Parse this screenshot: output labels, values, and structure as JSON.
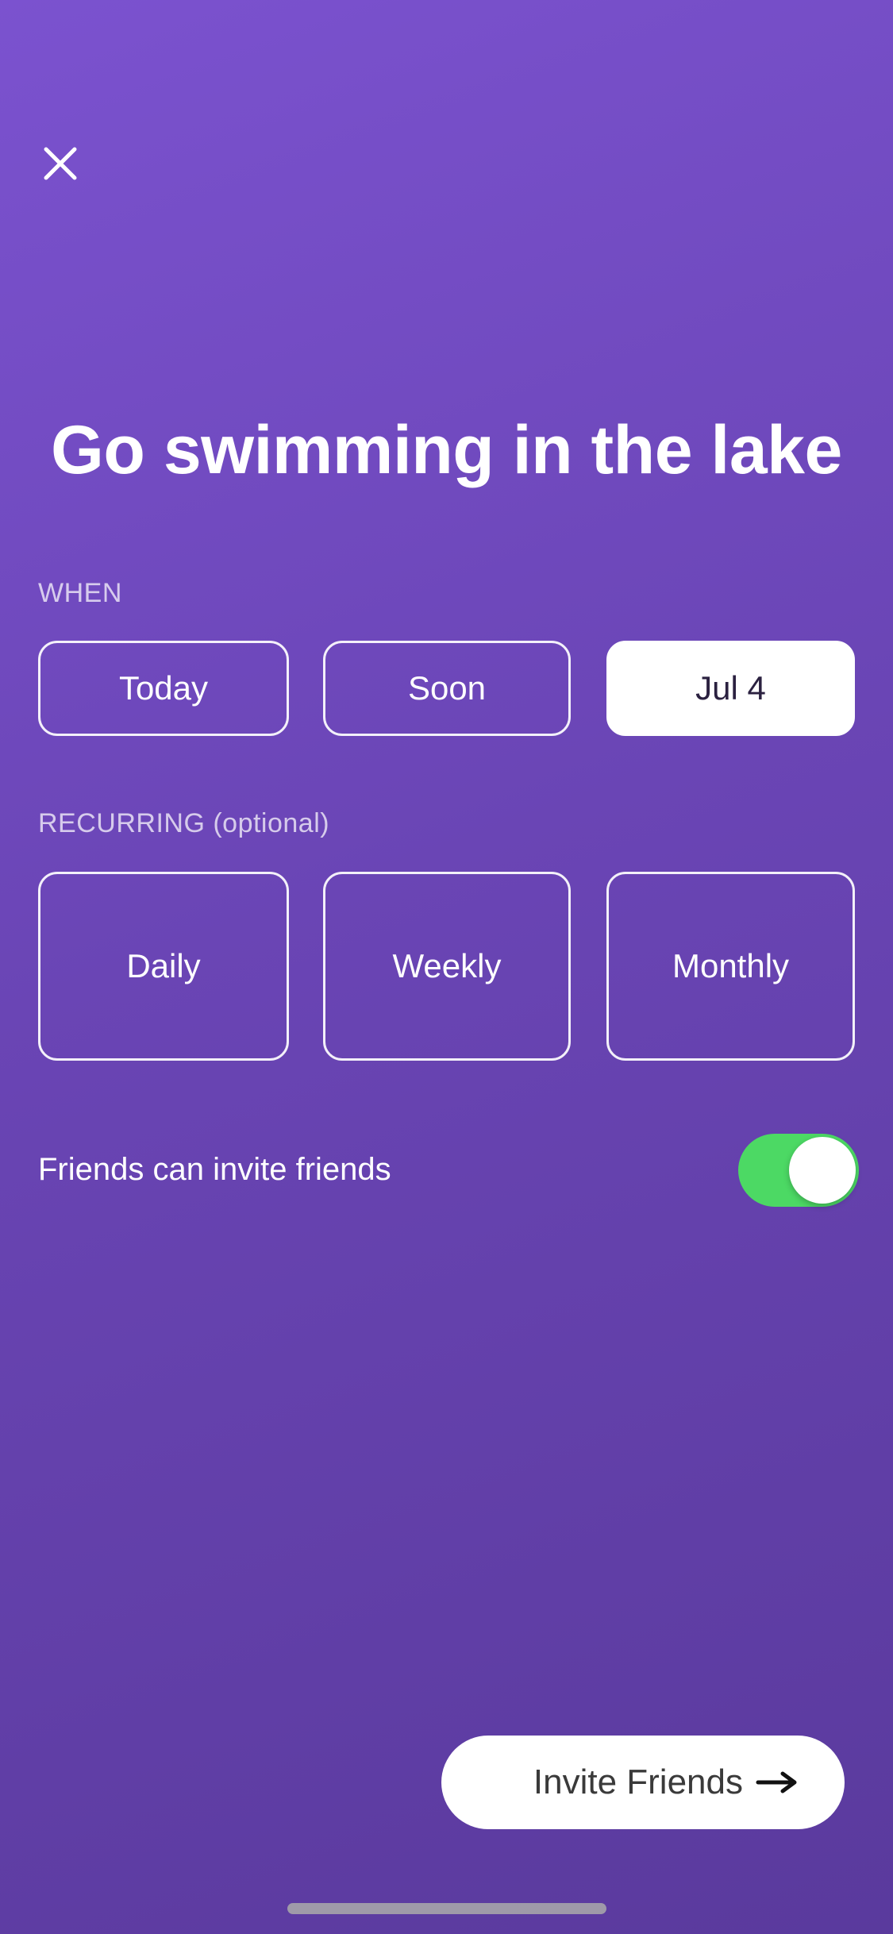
{
  "header": {
    "close_icon": "close-icon"
  },
  "event": {
    "title": "Go swimming in the lake"
  },
  "when": {
    "label": "WHEN",
    "options": [
      "Today",
      "Soon",
      "Jul 4"
    ],
    "selected": "Jul 4"
  },
  "recurring": {
    "label": "RECURRING (optional)",
    "options": [
      "Daily",
      "Weekly",
      "Monthly"
    ],
    "selected": null
  },
  "settings": {
    "friends_invite_label": "Friends can invite friends",
    "friends_invite_enabled": true
  },
  "footer": {
    "invite_label": "Invite Friends",
    "invite_icon": "arrow-right-icon"
  },
  "colors": {
    "background_top": "#7b52cf",
    "background_bottom": "#5a3a9d",
    "toggle_on": "#4cd964",
    "selected_option_bg": "#ffffff"
  }
}
